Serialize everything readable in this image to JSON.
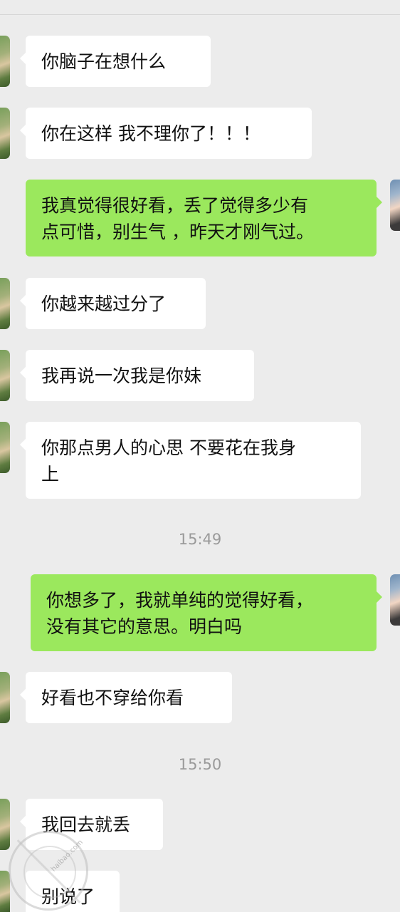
{
  "messages": [
    {
      "side": "in",
      "text": "你脑子在想什么"
    },
    {
      "side": "in",
      "text": "你在这样 我不理你了！！！"
    },
    {
      "side": "out",
      "text": "我真觉得很好看，丢了觉得多少有\n点可惜，别生气 ，昨天才刚气过。"
    },
    {
      "side": "in",
      "text": "你越来越过分了"
    },
    {
      "side": "in",
      "text": "我再说一次我是你妹"
    },
    {
      "side": "in",
      "text": "你那点男人的心思 不要花在我身\n上"
    },
    {
      "side": "time",
      "text": "15:49"
    },
    {
      "side": "out",
      "text": "你想多了，我就单纯的觉得好看，\n没有其它的意思。明白吗"
    },
    {
      "side": "in",
      "text": "好看也不穿给你看"
    },
    {
      "side": "time",
      "text": "15:50"
    },
    {
      "side": "in",
      "text": "我回去就丢"
    },
    {
      "side": "in",
      "text": "别说了"
    }
  ],
  "watermark": {
    "text": "haibao.com"
  }
}
